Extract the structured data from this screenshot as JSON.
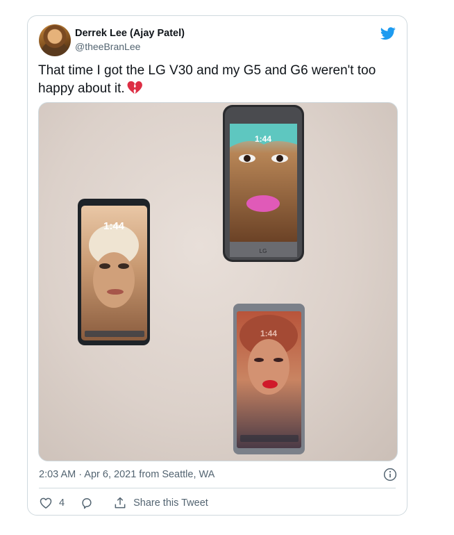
{
  "tweet": {
    "author_name": "Derrek Lee (Ajay Patel)",
    "author_handle": "@theeBranLee",
    "text": "That time I got the LG V30 and my G5 and G6 weren't too happy about it.",
    "emoji": "broken-heart-icon",
    "timestamp": "2:03 AM · Apr 6, 2021 from Seattle, WA",
    "like_count": "4",
    "share_label": "Share this Tweet"
  },
  "photo": {
    "phones": [
      {
        "model": "LG V30",
        "clock": "1:44"
      },
      {
        "model": "LG G5",
        "clock": "1:44"
      },
      {
        "model": "LG G6",
        "clock": "1:44"
      }
    ]
  },
  "colors": {
    "twitter_blue": "#1d9bf0",
    "text_primary": "#0f1419",
    "text_secondary": "#536471",
    "border": "#cfd9de"
  }
}
